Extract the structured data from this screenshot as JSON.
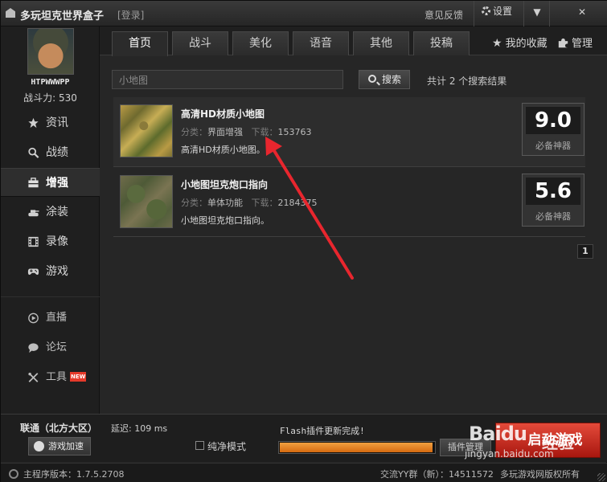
{
  "app": {
    "title": "多玩坦克世界盒子",
    "login": "[登录]",
    "feedback": "意见反馈",
    "settings": "设置",
    "minimize": "▼",
    "close": "✕"
  },
  "user": {
    "name": "HTPWWWPP",
    "power": "战斗力: 530"
  },
  "sidebar": {
    "items": [
      {
        "label": "资讯",
        "icon": "star-icon"
      },
      {
        "label": "战绩",
        "icon": "search-icon"
      },
      {
        "label": "增强",
        "icon": "toolbox-icon",
        "active": true
      },
      {
        "label": "涂装",
        "icon": "tank-icon"
      },
      {
        "label": "录像",
        "icon": "film-icon"
      },
      {
        "label": "游戏",
        "icon": "gamepad-icon"
      }
    ],
    "secondary": [
      {
        "label": "直播",
        "icon": "play-icon"
      },
      {
        "label": "论坛",
        "icon": "chat-bubble-icon"
      },
      {
        "label": "工具",
        "icon": "tools-icon",
        "badge": "NEW"
      }
    ]
  },
  "tabs": [
    "首页",
    "战斗",
    "美化",
    "语音",
    "其他",
    "投稿"
  ],
  "active_tab": "首页",
  "top_links": {
    "favorites": "我的收藏",
    "manage": "管理"
  },
  "search": {
    "value": "小地图",
    "button": "搜索",
    "result_text": "共计 2 个搜索结果"
  },
  "results": [
    {
      "title": "高清HD材质小地图",
      "category_label": "分类：",
      "category": "界面增强",
      "downloads_label": "下载：",
      "downloads": "153763",
      "description": "高清HD材质小地图。",
      "score": "9.0",
      "score_label": "必备神器"
    },
    {
      "title": "小地图坦克炮口指向",
      "category_label": "分类：",
      "category": "单体功能",
      "downloads_label": "下载：",
      "downloads": "2184375",
      "description": "小地图坦克炮口指向。",
      "score": "5.6",
      "score_label": "必备神器"
    }
  ],
  "pagination": {
    "current": "1"
  },
  "bottom": {
    "server": "联通（北方大区）",
    "latency": "延迟: 109 ms",
    "speed_button": "游戏加速",
    "pure_mode": "纯净模式",
    "flash_status": "Flash插件更新完成!",
    "progress": 0.99,
    "plugin_button": "插件管理",
    "start_button": "启动游戏"
  },
  "status": {
    "version": "主程序版本：1.7.5.2708",
    "qq_group": "交流YY群（新）：14511572",
    "copyright": "多玩游戏网版权所有"
  },
  "watermark": {
    "logo": "Baidu",
    "exp": "经验",
    "url": "jingyan.baidu.com"
  },
  "colors": {
    "accent_red": "#e53a2a",
    "progress_orange": "#e07a20",
    "arrow_red": "#e8262e"
  }
}
